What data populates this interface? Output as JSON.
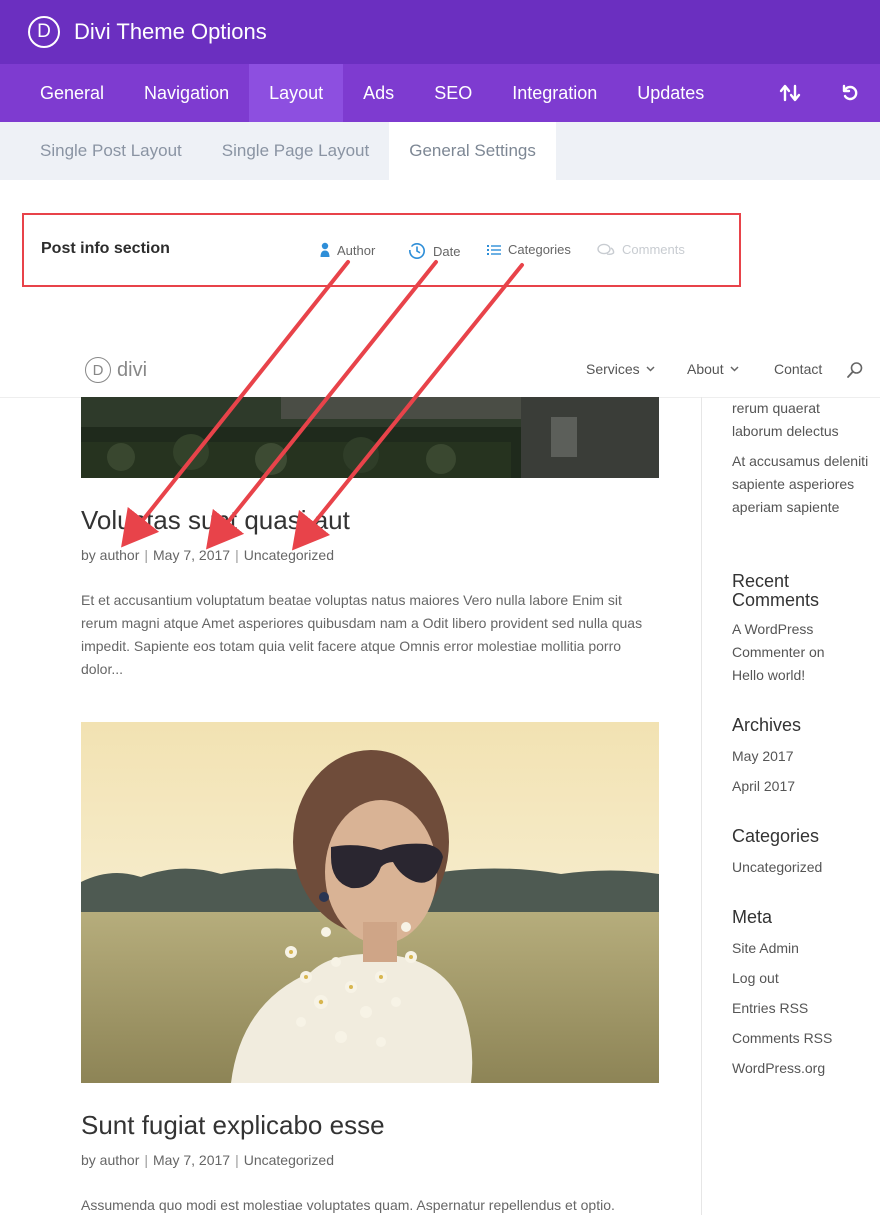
{
  "app": {
    "title": "Divi Theme Options",
    "logo_letter": "D"
  },
  "main_tabs": [
    {
      "label": "General"
    },
    {
      "label": "Navigation"
    },
    {
      "label": "Layout",
      "active": true
    },
    {
      "label": "Ads"
    },
    {
      "label": "SEO"
    },
    {
      "label": "Integration"
    },
    {
      "label": "Updates"
    }
  ],
  "tab_icons": [
    "import-export-icon",
    "reset-icon"
  ],
  "sub_tabs": [
    {
      "label": "Single Post Layout"
    },
    {
      "label": "Single Page Layout"
    },
    {
      "label": "General Settings",
      "active": true
    }
  ],
  "post_info": {
    "title": "Post info section",
    "options": [
      {
        "label": "Author",
        "icon": "user-icon",
        "enabled": true
      },
      {
        "label": "Date",
        "icon": "clock-icon",
        "enabled": true
      },
      {
        "label": "Categories",
        "icon": "list-icon",
        "enabled": true
      },
      {
        "label": "Comments",
        "icon": "comment-icon",
        "enabled": false
      }
    ]
  },
  "site": {
    "logo_letter": "D",
    "logo_text": "divi",
    "nav": [
      {
        "label": "Services",
        "has_dropdown": true
      },
      {
        "label": "About",
        "has_dropdown": true
      },
      {
        "label": "Contact",
        "has_dropdown": false
      }
    ]
  },
  "posts": [
    {
      "title": "Voluptas sunt quasi aut",
      "author": "by author",
      "date": "May 7, 2017",
      "category": "Uncategorized",
      "excerpt": "Et et accusantium voluptatum beatae voluptas natus maiores Vero nulla labore Enim sit rerum magni atque Amet asperiores quibusdam nam a Odit libero provident sed nulla quas impedit. Sapiente eos totam quia velit facere atque Omnis error molestiae mollitia porro dolor..."
    },
    {
      "title": "Sunt fugiat explicabo esse",
      "author": "by author",
      "date": "May 7, 2017",
      "category": "Uncategorized",
      "excerpt": "Assumenda quo modi est molestiae voluptates quam. Aspernatur repellendus et optio."
    }
  ],
  "sidebar": {
    "recent_posts": [
      "rerum quaerat laborum delectus",
      "At accusamus deleniti sapiente asperiores aperiam sapiente"
    ],
    "recent_comments": {
      "title": "Recent Comments",
      "items": [
        "A WordPress Commenter on Hello world!"
      ]
    },
    "archives": {
      "title": "Archives",
      "items": [
        "May 2017",
        "April 2017"
      ]
    },
    "categories": {
      "title": "Categories",
      "items": [
        "Uncategorized"
      ]
    },
    "meta": {
      "title": "Meta",
      "items": [
        "Site Admin",
        "Log out",
        "Entries RSS",
        "Comments RSS",
        "WordPress.org"
      ]
    }
  },
  "colors": {
    "header_purple": "#6b2fc0",
    "tabs_purple": "#7e3bd0",
    "active_tab": "#8d4fe0",
    "highlight_red": "#e8434a",
    "icon_blue": "#2e8ed8"
  }
}
